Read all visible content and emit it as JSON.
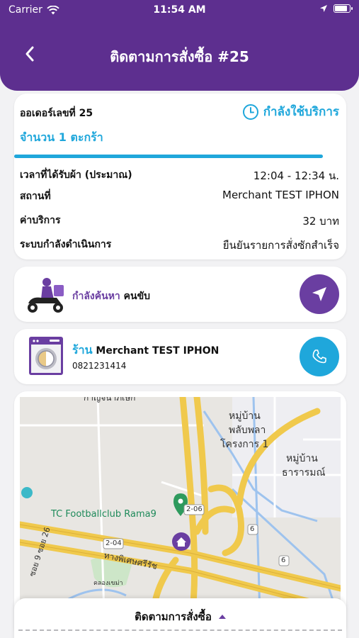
{
  "status_bar": {
    "carrier": "Carrier",
    "time": "11:54 AM",
    "battery_level": 0.9
  },
  "header": {
    "title": "ติดตามการสั่งซื้อ #25"
  },
  "order": {
    "number_label": "ออเดอร์เลขที่ 25",
    "status": "กำลังใช้บริการ",
    "basket_count": "จำนวน 1 ตะกร้า",
    "progress": 1.0,
    "rows": [
      {
        "label": "เวลาที่ได้รับผ้า (ประมาณ)",
        "value": "12:04 - 12:34 น."
      },
      {
        "label": "สถานที่",
        "value": "Merchant TEST IPHON"
      },
      {
        "label": "ค่าบริการ",
        "value": "32 บาท"
      },
      {
        "label": "ระบบกำลังดำเนินการ",
        "value": "ยืนยันรายการสั่งซักสำเร็จ"
      }
    ]
  },
  "driver": {
    "searching_label": "กำลังค้นหา",
    "driver_label": "คนขับ"
  },
  "store": {
    "prefix": "ร้าน",
    "name": "Merchant TEST IPHON",
    "phone": "0821231414"
  },
  "map": {
    "labels": {
      "village1": "หมู่บ้าน",
      "village1b": "พลับพลา",
      "village1c": "โครงการ 1",
      "village2": "หมู่บ้าน",
      "village2b": "ธารารมณ์",
      "poi": "TC Footballclub Rama9",
      "road_top": "กาญจนาภิเษก",
      "road_special": "ทางพิเศษศรีรัช",
      "route_204": "2-04",
      "route_206": "2-06",
      "route_6a": "6",
      "route_6b": "6",
      "soi": "ซอย 9 ซอย 26",
      "canal": "คลองเขม่า"
    }
  },
  "sheet": {
    "title": "ติดตามการสั่งซื้อ"
  },
  "colors": {
    "header": "#5d2f8f",
    "accent_blue": "#1fa7db",
    "accent_purple": "#6a3ea1"
  }
}
